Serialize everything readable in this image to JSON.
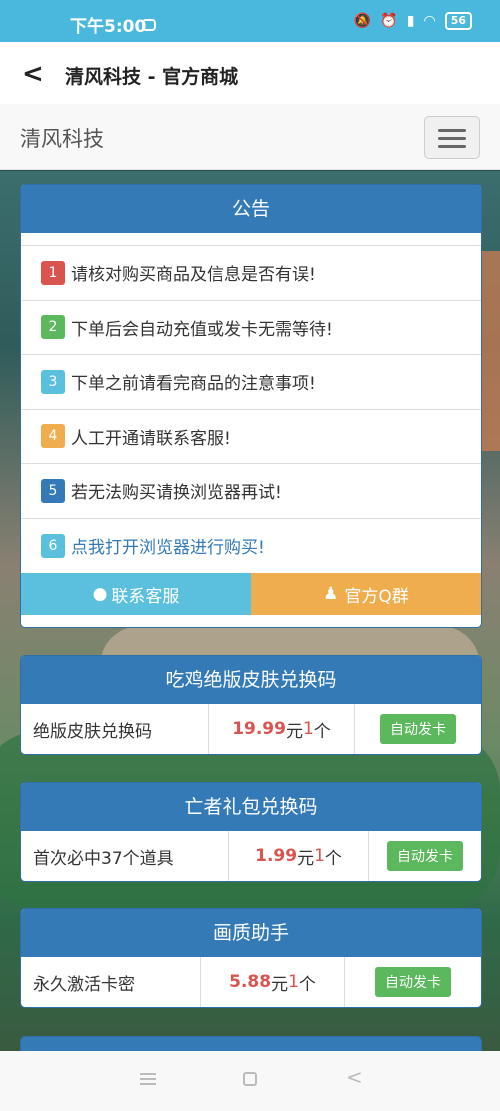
{
  "status": {
    "time": "下午5:00",
    "battery": "56"
  },
  "titlebar": {
    "back_icon": "chevron-left-icon",
    "title": "清风科技 - 官方商城"
  },
  "navbar": {
    "brand": "清风科技",
    "toggle_icon": "hamburger-icon"
  },
  "notice": {
    "title": "公告",
    "items": [
      {
        "num": "1",
        "text": "请核对购买商品及信息是否有误!"
      },
      {
        "num": "2",
        "text": "下单后会自动充值或发卡无需等待!"
      },
      {
        "num": "3",
        "text": "下单之前请看完商品的注意事项!"
      },
      {
        "num": "4",
        "text": "人工开通请联系客服!"
      },
      {
        "num": "5",
        "text": "若无法购买请换浏览器再试!"
      },
      {
        "num": "6",
        "text": "点我打开浏览器进行购买!"
      }
    ],
    "buttons": {
      "service": "联系客服",
      "group": "官方Q群"
    }
  },
  "products": [
    {
      "title": "吃鸡绝版皮肤兑换码",
      "name": "绝版皮肤兑换码",
      "price": "19.99",
      "unit": "元",
      "qty": "1",
      "qty_unit": "个",
      "action": "自动发卡"
    },
    {
      "title": "亡者礼包兑换码",
      "name": "首次必中37个道具",
      "price": "1.99",
      "unit": "元",
      "qty": "1",
      "qty_unit": "个",
      "action": "自动发卡"
    },
    {
      "title": "画质助手",
      "name": "永久激活卡密",
      "price": "5.88",
      "unit": "元",
      "qty": "1",
      "qty_unit": "个",
      "action": "自动发卡"
    }
  ],
  "colors": {
    "primary": "#337ab7",
    "success": "#5cb85c",
    "info": "#5bc0de",
    "warning": "#f0ad4e",
    "danger": "#d9534f"
  }
}
